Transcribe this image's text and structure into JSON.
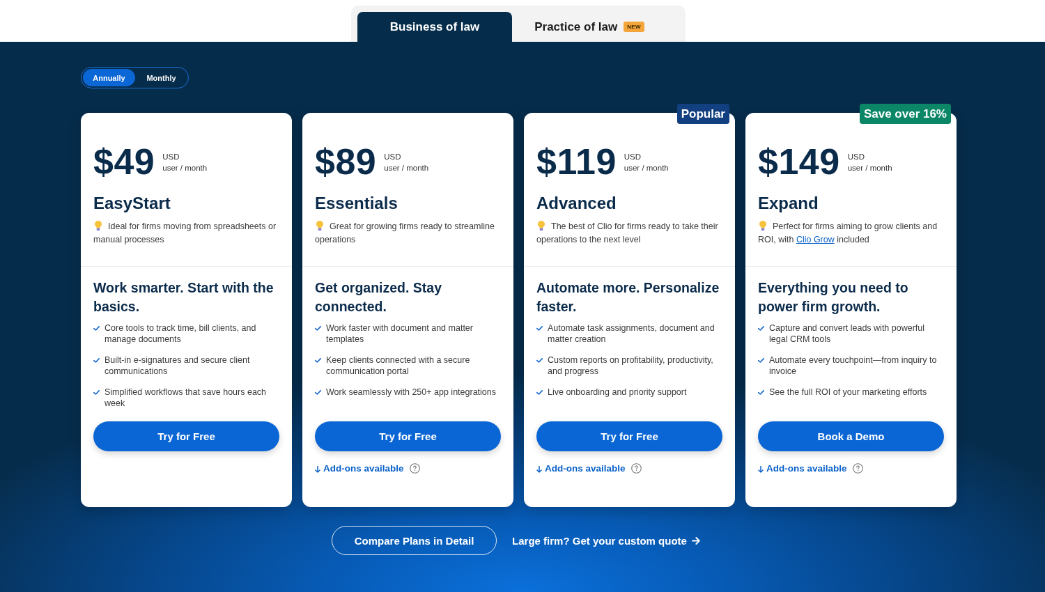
{
  "tabs": [
    {
      "label": "Business of law",
      "selected": true
    },
    {
      "label": "Practice of law",
      "selected": false,
      "badge": "NEW"
    }
  ],
  "billing_toggle": [
    {
      "label": "Annually",
      "selected": true
    },
    {
      "label": "Monthly",
      "selected": false
    }
  ],
  "plans": [
    {
      "price": "$49",
      "currency": "USD",
      "period": "user / month",
      "name": "EasyStart",
      "description": [
        {
          "kind": "text",
          "text": "Ideal for firms moving from spreadsheets or manual processes"
        }
      ],
      "headline": "Work smarter. Start with the basics.",
      "features": [
        "Core tools to track time, bill clients, and manage documents",
        "Built-in e-signatures and secure client communications",
        "Simplified workflows that save hours each week"
      ],
      "button": "Try for Free"
    },
    {
      "price": "$89",
      "currency": "USD",
      "period": "user / month",
      "name": "Essentials",
      "description": [
        {
          "kind": "text",
          "text": "Great for growing firms ready to streamline operations"
        }
      ],
      "headline": "Get organized. Stay connected.",
      "features": [
        "Work faster with document and matter templates",
        "Keep clients connected with a secure communication portal",
        "Work seamlessly with 250+ app integrations"
      ],
      "button": "Try for Free",
      "add_ons": "Add-ons available"
    },
    {
      "badge": {
        "label": "Popular",
        "color": "#123f7f"
      },
      "price": "$119",
      "currency": "USD",
      "period": "user / month",
      "name": "Advanced",
      "description": [
        {
          "kind": "text",
          "text": "The best of Clio for firms ready to take their operations to the next level"
        }
      ],
      "headline": "Automate more. Personalize faster.",
      "features": [
        "Automate task assignments, document and matter creation",
        "Custom reports on profitability, productivity, and progress",
        "Live onboarding and priority support"
      ],
      "button": "Try for Free",
      "add_ons": "Add-ons available"
    },
    {
      "badge": {
        "label": "Save over 16%",
        "color": "#0b8667"
      },
      "price": "$149",
      "currency": "USD",
      "period": "user / month",
      "name": "Expand",
      "description": [
        {
          "kind": "text",
          "text": "Perfect for firms aiming to grow clients and ROI, with "
        },
        {
          "kind": "link",
          "text": "Clio Grow"
        },
        {
          "kind": "text",
          "text": " included"
        }
      ],
      "headline": "Everything you need to power firm growth.",
      "features": [
        "Capture and convert leads with powerful legal CRM tools",
        "Automate every touchpoint—from inquiry to invoice",
        "See the full ROI of your marketing efforts"
      ],
      "button": "Book a Demo",
      "add_ons": "Add-ons available"
    }
  ],
  "footer": {
    "compare_button": "Compare Plans in Detail",
    "quote_link": "Large firm? Get your custom quote"
  }
}
